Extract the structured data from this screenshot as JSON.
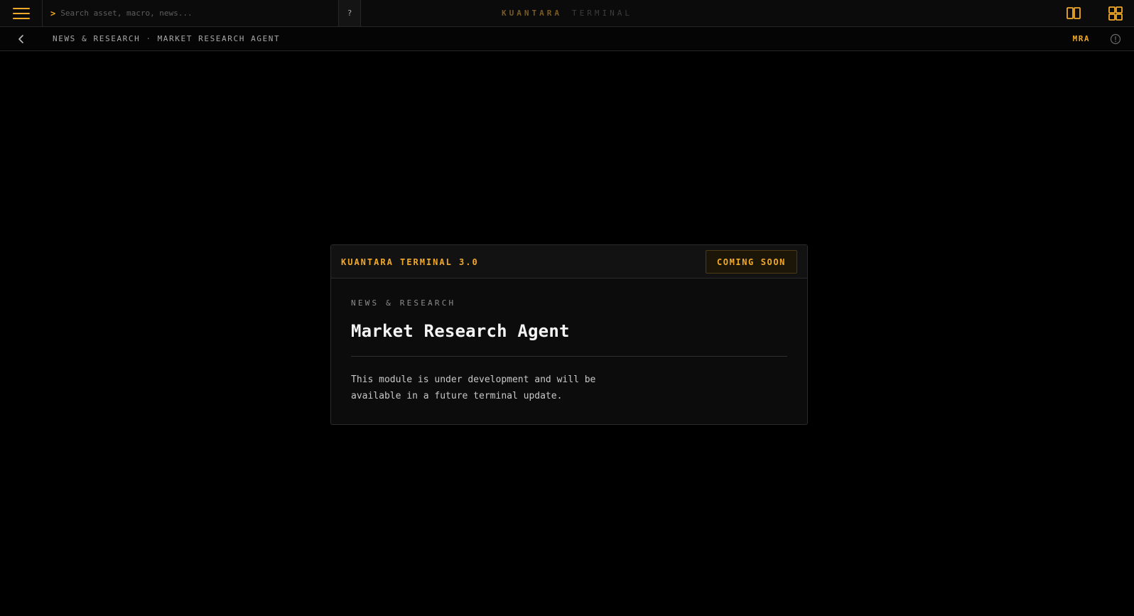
{
  "topbar": {
    "menu_icon": "hamburger-menu-icon",
    "search": {
      "prompt": ">",
      "placeholder": "Search asset, macro, news...",
      "value": ""
    },
    "help_label": "?",
    "brand_primary": "KUANTARA",
    "brand_secondary": "TERMINAL",
    "layout_buttons": [
      "split-columns-icon",
      "grid-layout-icon"
    ]
  },
  "breadcrumb_bar": {
    "back_icon": "chevron-left-icon",
    "section": "NEWS & RESEARCH",
    "separator": "·",
    "page": "MARKET RESEARCH AGENT",
    "code": "MRA",
    "info_icon": "info-circle-icon"
  },
  "card": {
    "title": "KUANTARA TERMINAL 3.0",
    "badge": "COMING SOON",
    "eyebrow": "NEWS & RESEARCH",
    "heading": "Market Research Agent",
    "description": "This module is under development and will be available in a future terminal update."
  },
  "colors": {
    "accent": "#f0a92a",
    "background": "#000000",
    "panel": "#0c0c0c",
    "border": "#2b2b2b"
  }
}
